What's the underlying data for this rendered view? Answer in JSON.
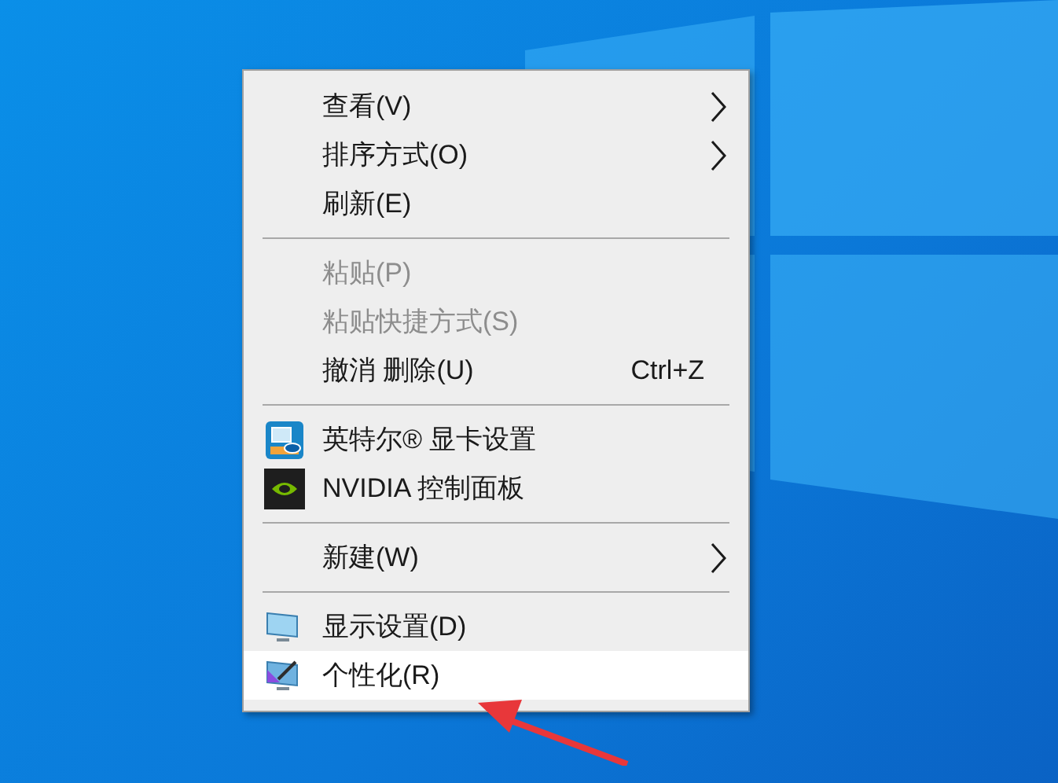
{
  "context_menu": {
    "sections": [
      {
        "items": [
          {
            "label": "查看(V)",
            "kind": "plain",
            "submenu": true,
            "disabled": false,
            "selected": false
          },
          {
            "label": "排序方式(O)",
            "kind": "plain",
            "submenu": true,
            "disabled": false,
            "selected": false
          },
          {
            "label": "刷新(E)",
            "kind": "plain",
            "submenu": false,
            "disabled": false,
            "selected": false
          }
        ]
      },
      {
        "items": [
          {
            "label": "粘贴(P)",
            "kind": "plain",
            "submenu": false,
            "disabled": true,
            "selected": false
          },
          {
            "label": "粘贴快捷方式(S)",
            "kind": "plain",
            "submenu": false,
            "disabled": true,
            "selected": false
          },
          {
            "label": "撤消 删除(U)",
            "kind": "plain",
            "submenu": false,
            "disabled": false,
            "selected": false,
            "shortcut": "Ctrl+Z"
          }
        ]
      },
      {
        "items": [
          {
            "label": "英特尔® 显卡设置",
            "kind": "chip",
            "submenu": false,
            "disabled": false,
            "selected": false
          },
          {
            "label": "NVIDIA 控制面板",
            "kind": "gpu",
            "submenu": false,
            "disabled": false,
            "selected": false
          }
        ]
      },
      {
        "items": [
          {
            "label": "新建(W)",
            "kind": "plain",
            "submenu": true,
            "disabled": false,
            "selected": false
          }
        ]
      },
      {
        "items": [
          {
            "label": "显示设置(D)",
            "kind": "monitor",
            "submenu": false,
            "disabled": false,
            "selected": false
          },
          {
            "label": "个性化(R)",
            "kind": "brush",
            "submenu": false,
            "disabled": false,
            "selected": true
          }
        ]
      }
    ]
  }
}
